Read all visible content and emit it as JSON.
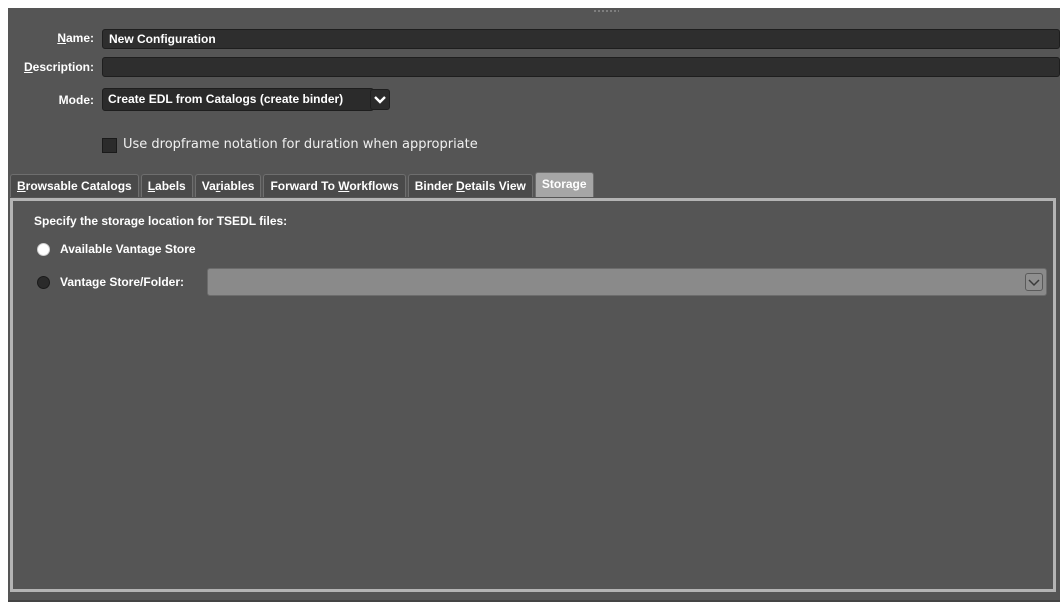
{
  "form": {
    "name_label_u": "N",
    "name_label_rest": "ame:",
    "name_value": "New Configuration",
    "description_label_u": "D",
    "description_label_rest": "escription:",
    "description_value": "",
    "mode_label": "Mode:",
    "mode_value": "Create EDL from Catalogs (create binder)",
    "dropframe_label": "Use dropframe notation for duration when appropriate",
    "dropframe_checked": false
  },
  "tabs": [
    {
      "u": "B",
      "rest": "rowsable Catalogs",
      "pre": ""
    },
    {
      "u": "L",
      "rest": "abels",
      "pre": ""
    },
    {
      "pre": "Va",
      "u": "r",
      "rest": "iables"
    },
    {
      "pre": "Forward To ",
      "u": "W",
      "rest": "orkflows"
    },
    {
      "pre": "Binder ",
      "u": "D",
      "rest": "etails View"
    },
    {
      "pre": "",
      "u": "",
      "rest": "Storage"
    }
  ],
  "active_tab": "Storage",
  "storage": {
    "section_label": "Specify the storage location for TSEDL files:",
    "option_available_label": "Available Vantage Store",
    "option_available_selected": true,
    "option_folder_label": "Vantage Store/Folder:",
    "option_folder_selected": false,
    "folder_value": ""
  },
  "colors": {
    "panel_bg": "#555555",
    "active_tab_bg": "#a6a6a6",
    "field_bg": "#2e2e2e"
  }
}
